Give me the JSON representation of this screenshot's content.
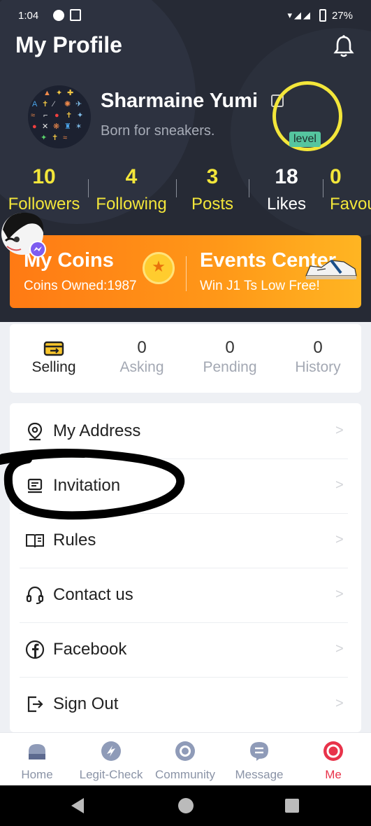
{
  "status_bar": {
    "time": "1:04",
    "battery": "27%"
  },
  "header": {
    "title": "My Profile",
    "username": "Sharmaine Yumi",
    "bio": "Born for sneakers.",
    "level_label": "level"
  },
  "stats": [
    {
      "num": "10",
      "label": "Followers"
    },
    {
      "num": "4",
      "label": "Following"
    },
    {
      "num": "3",
      "label": "Posts"
    },
    {
      "num": "18",
      "label": "Likes"
    },
    {
      "num": "0",
      "label": "Favou"
    }
  ],
  "promo": {
    "coins_title": "My Coins",
    "coins_sub": "Coins Owned:1987",
    "events_title": "Events Center",
    "events_sub": "Win J1 Ts Low Free!"
  },
  "orders": [
    {
      "num": "",
      "label": "Selling"
    },
    {
      "num": "0",
      "label": "Asking"
    },
    {
      "num": "0",
      "label": "Pending"
    },
    {
      "num": "0",
      "label": "History"
    }
  ],
  "menu": [
    {
      "label": "My Address",
      "icon": "location-pin-icon"
    },
    {
      "label": "Invitation",
      "icon": "invitation-icon"
    },
    {
      "label": "Rules",
      "icon": "book-icon"
    },
    {
      "label": "Contact us",
      "icon": "headset-icon"
    },
    {
      "label": "Facebook",
      "icon": "facebook-icon"
    },
    {
      "label": "Sign Out",
      "icon": "sign-out-icon"
    }
  ],
  "bottom_nav": [
    {
      "label": "Home",
      "icon": "home-icon"
    },
    {
      "label": "Legit-Check",
      "icon": "legit-check-icon"
    },
    {
      "label": "Community",
      "icon": "community-icon"
    },
    {
      "label": "Message",
      "icon": "message-icon"
    },
    {
      "label": "Me",
      "icon": "me-icon",
      "active": true
    }
  ],
  "colors": {
    "accent_yellow": "#f3e63a",
    "promo_orange": "#ff7a14",
    "active_red": "#e8334a",
    "header_bg": "#262a35"
  }
}
